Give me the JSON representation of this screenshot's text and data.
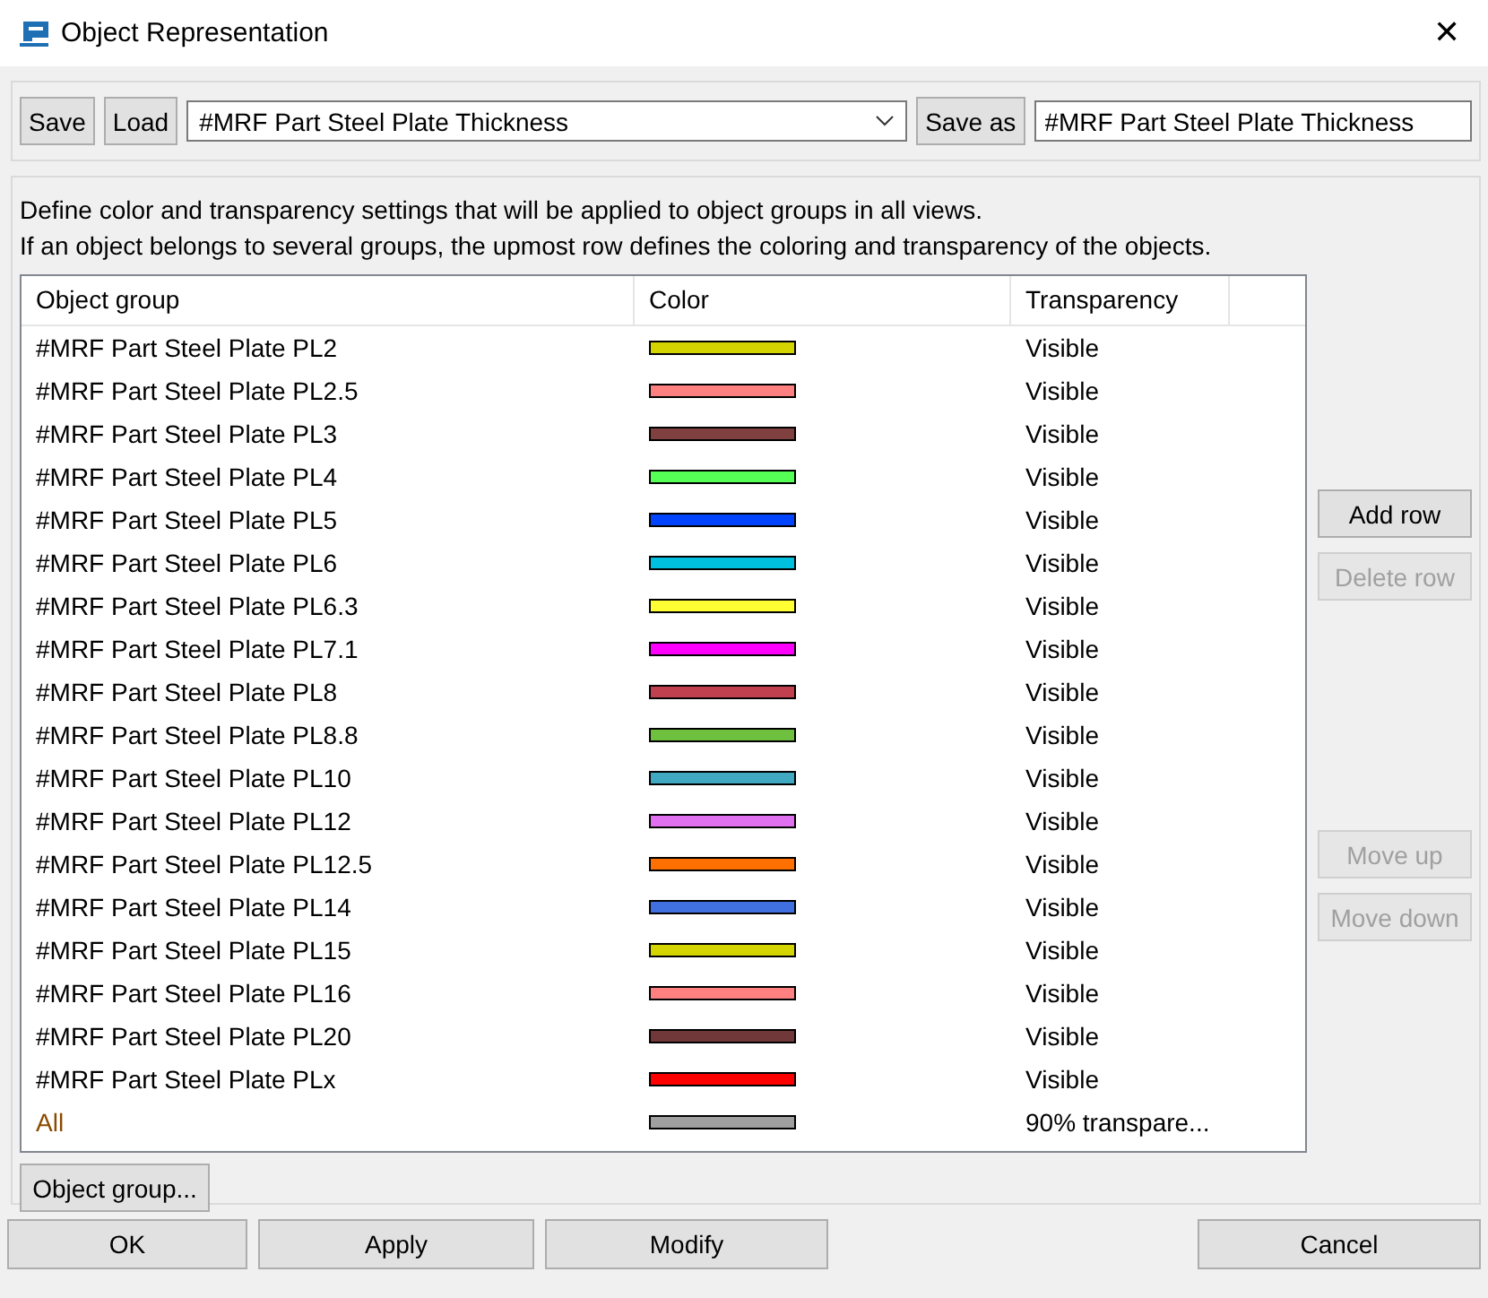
{
  "window": {
    "title": "Object Representation",
    "close": "✕"
  },
  "toolbar": {
    "save": "Save",
    "load": "Load",
    "selected_file": "#MRF Part Steel Plate Thickness",
    "save_as": "Save as",
    "save_as_name": "#MRF Part Steel Plate Thickness"
  },
  "description": [
    "Define color and transparency settings that will be applied to object groups in all views.",
    "If an object belongs to several groups, the upmost row defines the coloring and transparency of the objects."
  ],
  "table": {
    "columns": [
      "Object group",
      "Color",
      "Transparency"
    ],
    "rows": [
      {
        "kind": "group",
        "group": "#MRF Part Steel Plate PL2",
        "color": "#d4d400",
        "transparency": "Visible"
      },
      {
        "kind": "group",
        "group": "#MRF Part Steel Plate PL2.5",
        "color": "#ff8080",
        "transparency": "Visible"
      },
      {
        "kind": "group",
        "group": "#MRF Part Steel Plate PL3",
        "color": "#804040",
        "transparency": "Visible"
      },
      {
        "kind": "group",
        "group": "#MRF Part Steel Plate PL4",
        "color": "#55ff55",
        "transparency": "Visible"
      },
      {
        "kind": "group",
        "group": "#MRF Part Steel Plate PL5",
        "color": "#0044ff",
        "transparency": "Visible"
      },
      {
        "kind": "group",
        "group": "#MRF Part Steel Plate PL6",
        "color": "#00c0e0",
        "transparency": "Visible"
      },
      {
        "kind": "group",
        "group": "#MRF Part Steel Plate PL6.3",
        "color": "#ffff33",
        "transparency": "Visible"
      },
      {
        "kind": "group",
        "group": "#MRF Part Steel Plate PL7.1",
        "color": "#ff00ff",
        "transparency": "Visible"
      },
      {
        "kind": "group",
        "group": "#MRF Part Steel Plate PL8",
        "color": "#c04050",
        "transparency": "Visible"
      },
      {
        "kind": "group",
        "group": "#MRF Part Steel Plate PL8.8",
        "color": "#70c040",
        "transparency": "Visible"
      },
      {
        "kind": "group",
        "group": "#MRF Part Steel Plate PL10",
        "color": "#40a8c0",
        "transparency": "Visible"
      },
      {
        "kind": "group",
        "group": "#MRF Part Steel Plate PL12",
        "color": "#e070f0",
        "transparency": "Visible"
      },
      {
        "kind": "group",
        "group": "#MRF Part Steel Plate PL12.5",
        "color": "#ff7000",
        "transparency": "Visible"
      },
      {
        "kind": "group",
        "group": "#MRF Part Steel Plate PL14",
        "color": "#4070e0",
        "transparency": "Visible"
      },
      {
        "kind": "group",
        "group": "#MRF Part Steel Plate PL15",
        "color": "#d4d400",
        "transparency": "Visible"
      },
      {
        "kind": "group",
        "group": "#MRF Part Steel Plate PL16",
        "color": "#ff8080",
        "transparency": "Visible"
      },
      {
        "kind": "group",
        "group": "#MRF Part Steel Plate PL20",
        "color": "#703838",
        "transparency": "Visible"
      },
      {
        "kind": "group",
        "group": "#MRF Part Steel Plate PLx",
        "color": "#ff0000",
        "transparency": "Visible"
      },
      {
        "kind": "all",
        "group": "All",
        "color": "#a0a0a0",
        "transparency": "90% transpare..."
      }
    ]
  },
  "side_buttons": [
    {
      "label": "Add row",
      "disabled": false
    },
    {
      "label": "Delete row",
      "disabled": true
    },
    {
      "label": "Move up",
      "disabled": true
    },
    {
      "label": "Move down",
      "disabled": true
    }
  ],
  "object_group_button": "Object group...",
  "buttons": [
    "OK",
    "Apply",
    "Modify",
    "Cancel"
  ]
}
